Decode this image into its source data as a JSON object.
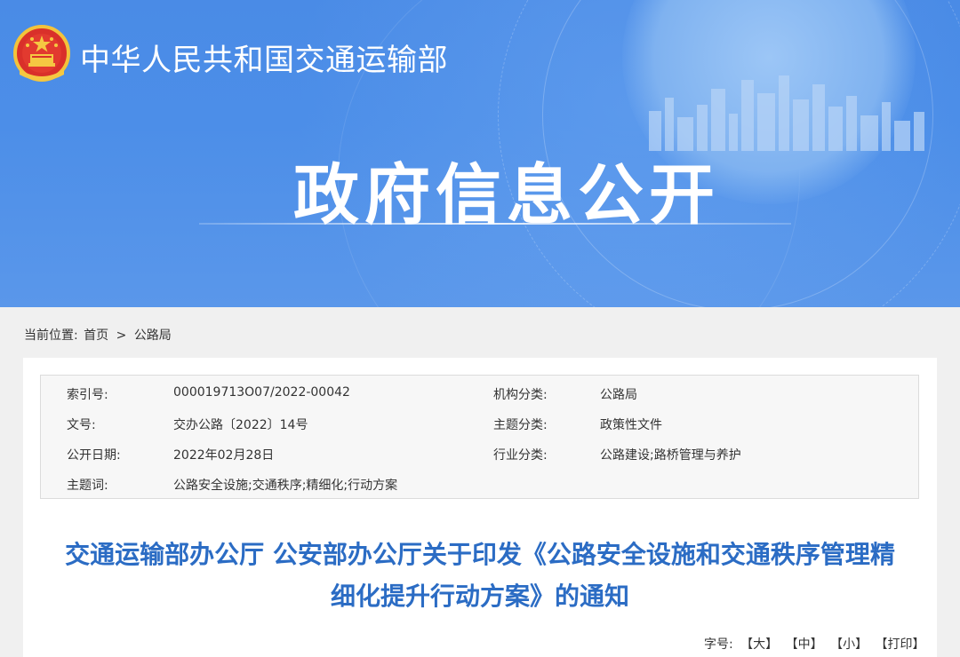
{
  "header": {
    "ministry_name": "中华人民共和国交通运输部",
    "section_title": "政府信息公开"
  },
  "breadcrumb": {
    "label": "当前位置:",
    "home": "首页",
    "separator": ">",
    "current": "公路局"
  },
  "meta": {
    "index_label": "索引号:",
    "index_value": "000019713O07/2022-00042",
    "org_label": "机构分类:",
    "org_value": "公路局",
    "doc_no_label": "文号:",
    "doc_no_value": "交办公路〔2022〕14号",
    "topic_label": "主题分类:",
    "topic_value": "政策性文件",
    "date_label": "公开日期:",
    "date_value": "2022年02月28日",
    "industry_label": "行业分类:",
    "industry_value": "公路建设;路桥管理与养护",
    "keywords_label": "主题词:",
    "keywords_value": "公路安全设施;交通秩序;精细化;行动方案"
  },
  "article": {
    "title_line1": "交通运输部办公厅 公安部办公厅关于印发《公路安全设施和交通秩序管理精",
    "title_line2": "细化提升行动方案》的通知"
  },
  "font_controls": {
    "label": "字号:",
    "large": "【大】",
    "medium": "【中】",
    "small": "【小】",
    "print": "【打印】"
  },
  "colors": {
    "banner_blue": "#4a8be6",
    "title_blue": "#2b6cc4"
  }
}
